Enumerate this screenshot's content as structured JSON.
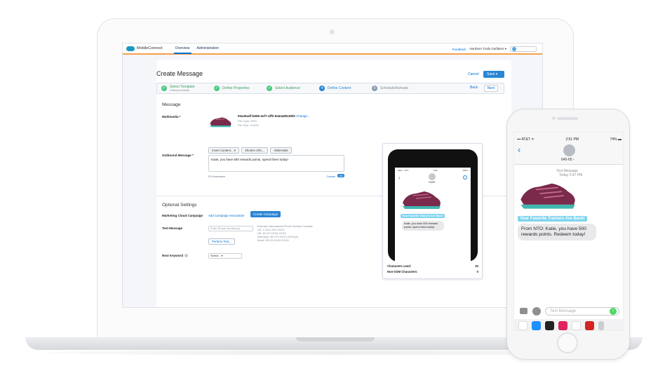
{
  "app": {
    "name": "MobileConnect",
    "tabs": [
      "Overview",
      "Administration"
    ],
    "feedback": "Feedback",
    "org": "Northern Trails Outfitters ▾"
  },
  "page": {
    "title": "Create Message",
    "cancel": "Cancel",
    "save": "Save ▾"
  },
  "wizard": {
    "steps": [
      {
        "label": "Select Template",
        "sub": "Outbound Media",
        "state": "done"
      },
      {
        "label": "Define Properties",
        "sub": "",
        "state": "done"
      },
      {
        "label": "Select Audience",
        "sub": "",
        "state": "done"
      },
      {
        "label": "Define Content",
        "sub": "",
        "state": "current",
        "num": "4"
      },
      {
        "label": "Schedule/Activate",
        "sub": "",
        "state": "todo",
        "num": "5"
      }
    ],
    "back": "Back",
    "next": "Next"
  },
  "message": {
    "section": "Message",
    "multimedia_label": "Multimedia *",
    "file_name": "93a26adf-b696-4ef7-affb-9a63a85108f4",
    "change": "Change...",
    "file_type": "File Type: PNG",
    "file_size": "File Size: 212KB",
    "outbound_label": "Outbound Message *",
    "toolbar": [
      "Insert Content... ▾",
      "Shorten URL...",
      "Abbreviate"
    ],
    "body": "Katie, you have 500 rewards points, spend them today!",
    "chars": "53 characters",
    "cancel": "Cancel",
    "ok": "OK"
  },
  "optional": {
    "section": "Optional Settings",
    "mc_label": "Marketing Cloud Campaign",
    "add_association": "Add Campaign Association",
    "create_campaign": "Create Campaign",
    "test_label": "Test Message",
    "phone_placeholder": "Enter Phone Number(s)",
    "help_lines": [
      "Example International Phone Number Formats:",
      "US: 1-XXX-XXX-XXXX",
      "UK: 44-XX-XXXX-XXXX",
      "Germany: 49-YYY-XXXX-XXXX(X)",
      "Brazil: 55-XX-XXXX-XXXX"
    ],
    "perform_test": "Perform Test...",
    "next_keyword_label": "Next Keyword",
    "select_placeholder": "Select...      ▾"
  },
  "preview": {
    "status_left": "●●●○○ ATT",
    "status_time": "9:41",
    "status_right": "100%",
    "contact": "04035",
    "caption": "Your Favorite Trainers Are Back!",
    "bubble": "Katie, you have 500 rewards points, spend them today!",
    "chars_used_label": "Characters used:",
    "chars_used": "53",
    "non_gsm_label": "Non-GSM Characters:",
    "non_gsm": "0"
  },
  "iphone": {
    "carrier": "▪▪▪ AT&T ᯤ",
    "time": "2:51 PM",
    "battery": "74% ▬",
    "contact": "645-65 ›",
    "meta_line1": "Text Message",
    "meta_line2": "Today 2:47 PM",
    "caption": "Your Favorite Trainers Are Back!",
    "bubble": "From NTO: Katie, you have 500 rewards points. Redeem today!",
    "input_placeholder": "Text Message"
  },
  "colors": {
    "brand_blue": "#2a86d5",
    "success_green": "#4bca81",
    "header_accent": "#f59f4a",
    "imessage_caption": "#7fd4ef"
  }
}
